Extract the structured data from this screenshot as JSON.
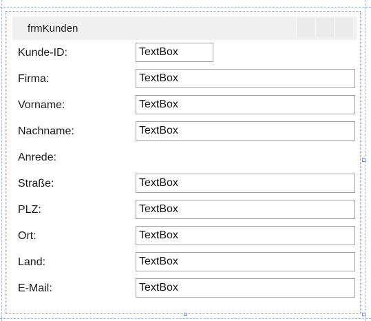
{
  "form": {
    "title": "frmKunden"
  },
  "fields": [
    {
      "label": "Kunde-ID:",
      "value": "TextBox"
    },
    {
      "label": "Firma:",
      "value": "TextBox"
    },
    {
      "label": "Vorname:",
      "value": "TextBox"
    },
    {
      "label": "Nachname:",
      "value": "TextBox"
    },
    {
      "label": "Anrede:",
      "value": ""
    },
    {
      "label": "Straße:",
      "value": "TextBox"
    },
    {
      "label": "PLZ:",
      "value": "TextBox"
    },
    {
      "label": "Ort:",
      "value": "TextBox"
    },
    {
      "label": "Land:",
      "value": "TextBox"
    },
    {
      "label": "E-Mail:",
      "value": "TextBox"
    }
  ]
}
